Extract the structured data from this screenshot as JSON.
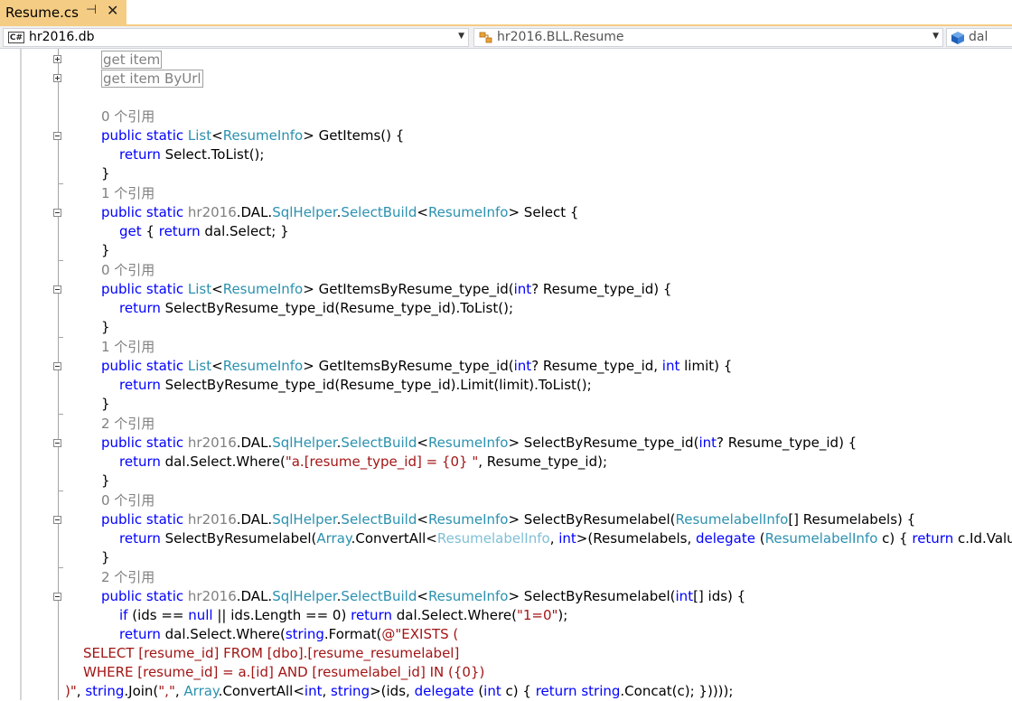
{
  "tab": {
    "title": "Resume.cs",
    "pin": "⊣",
    "close": "✕"
  },
  "navbar": {
    "project": {
      "icon": "csharp-file-icon",
      "label": "hr2016.db"
    },
    "type": {
      "icon": "class-icon",
      "label": "hr2016.BLL.Resume"
    },
    "member": {
      "icon": "field-icon",
      "label": "dal"
    }
  },
  "colors": {
    "tab_active": "#f5cc84",
    "keyword": "#0000ff",
    "type": "#2b91af",
    "string": "#a31515",
    "reference": "#808080"
  },
  "code": {
    "collapsed_1": "get item",
    "collapsed_2": "get item ByUrl",
    "l1_ref": "0 个引用",
    "l1_sig": [
      "public",
      " ",
      "static",
      " ",
      "List",
      "<",
      "ResumeInfo",
      "> GetItems() {"
    ],
    "l1_body": [
      "return",
      " Select.ToList();"
    ],
    "close": "}",
    "l2_ref": "1 个引用",
    "l2_sig": [
      "public",
      " ",
      "static",
      " ",
      "hr2016",
      ".DAL.",
      "SqlHelper",
      ".",
      "SelectBuild",
      "<",
      "ResumeInfo",
      "> Select {"
    ],
    "l2_body": [
      "get",
      " { ",
      "return",
      " dal.Select; }"
    ],
    "l3_ref": "0 个引用",
    "l3_sig": [
      "public",
      " ",
      "static",
      " ",
      "List",
      "<",
      "ResumeInfo",
      "> GetItemsByResume_type_id(",
      "int",
      "? Resume_type_id) {"
    ],
    "l3_body": [
      "return",
      " SelectByResume_type_id(Resume_type_id).ToList();"
    ],
    "l4_ref": "1 个引用",
    "l4_sig": [
      "public",
      " ",
      "static",
      " ",
      "List",
      "<",
      "ResumeInfo",
      "> GetItemsByResume_type_id(",
      "int",
      "? Resume_type_id, ",
      "int",
      " limit) {"
    ],
    "l4_body": [
      "return",
      " SelectByResume_type_id(Resume_type_id).Limit(limit).ToList();"
    ],
    "l5_ref": "2 个引用",
    "l5_sig": [
      "public",
      " ",
      "static",
      " ",
      "hr2016",
      ".DAL.",
      "SqlHelper",
      ".",
      "SelectBuild",
      "<",
      "ResumeInfo",
      "> SelectByResume_type_id(",
      "int",
      "? Resume_type_id) {"
    ],
    "l5_body": [
      "return",
      " dal.Select.Where(",
      "\"a.[resume_type_id] = {0} \"",
      ", Resume_type_id);"
    ],
    "l6_ref": "0 个引用",
    "l6_sig": [
      "public",
      " ",
      "static",
      " ",
      "hr2016",
      ".DAL.",
      "SqlHelper",
      ".",
      "SelectBuild",
      "<",
      "ResumeInfo",
      "> SelectByResumelabel(",
      "ResumelabelInfo",
      "[] Resumelabels) {"
    ],
    "l6_body": [
      "return",
      " SelectByResumelabel(",
      "Array",
      ".ConvertAll<",
      "ResumelabelInfo",
      ", ",
      "int",
      ">(Resumelabels, ",
      "delegate",
      " (",
      "ResumelabelInfo",
      " c) { ",
      "return",
      " c.Id.Value; }));"
    ],
    "l7_ref": "2 个引用",
    "l7_sig": [
      "public",
      " ",
      "static",
      " ",
      "hr2016",
      ".DAL.",
      "SqlHelper",
      ".",
      "SelectBuild",
      "<",
      "ResumeInfo",
      "> SelectByResumelabel(",
      "int",
      "[] ids) {"
    ],
    "l7_if": [
      "if",
      " (ids == ",
      "null",
      " || ids.Length == 0) ",
      "return",
      " dal.Select.Where(",
      "\"1=0\"",
      ");"
    ],
    "l7_ret": [
      "return",
      " dal.Select.Where(",
      "string",
      ".Format(",
      "@\"EXISTS ("
    ],
    "l7_sql1": "SELECT [resume_id] FROM [dbo].[resume_resumelabel]",
    "l7_sql2": "WHERE [resume_id] = a.[id] AND [resumelabel_id] IN ({0})",
    "l7_last": [
      ")\"",
      ", ",
      "string",
      ".Join(",
      "\",\"",
      ", ",
      "Array",
      ".ConvertAll<",
      "int",
      ", ",
      "string",
      ">(ids, ",
      "delegate",
      " (",
      "int",
      " c) { ",
      "return",
      " ",
      "string",
      ".Concat(c); }))));"
    ]
  }
}
